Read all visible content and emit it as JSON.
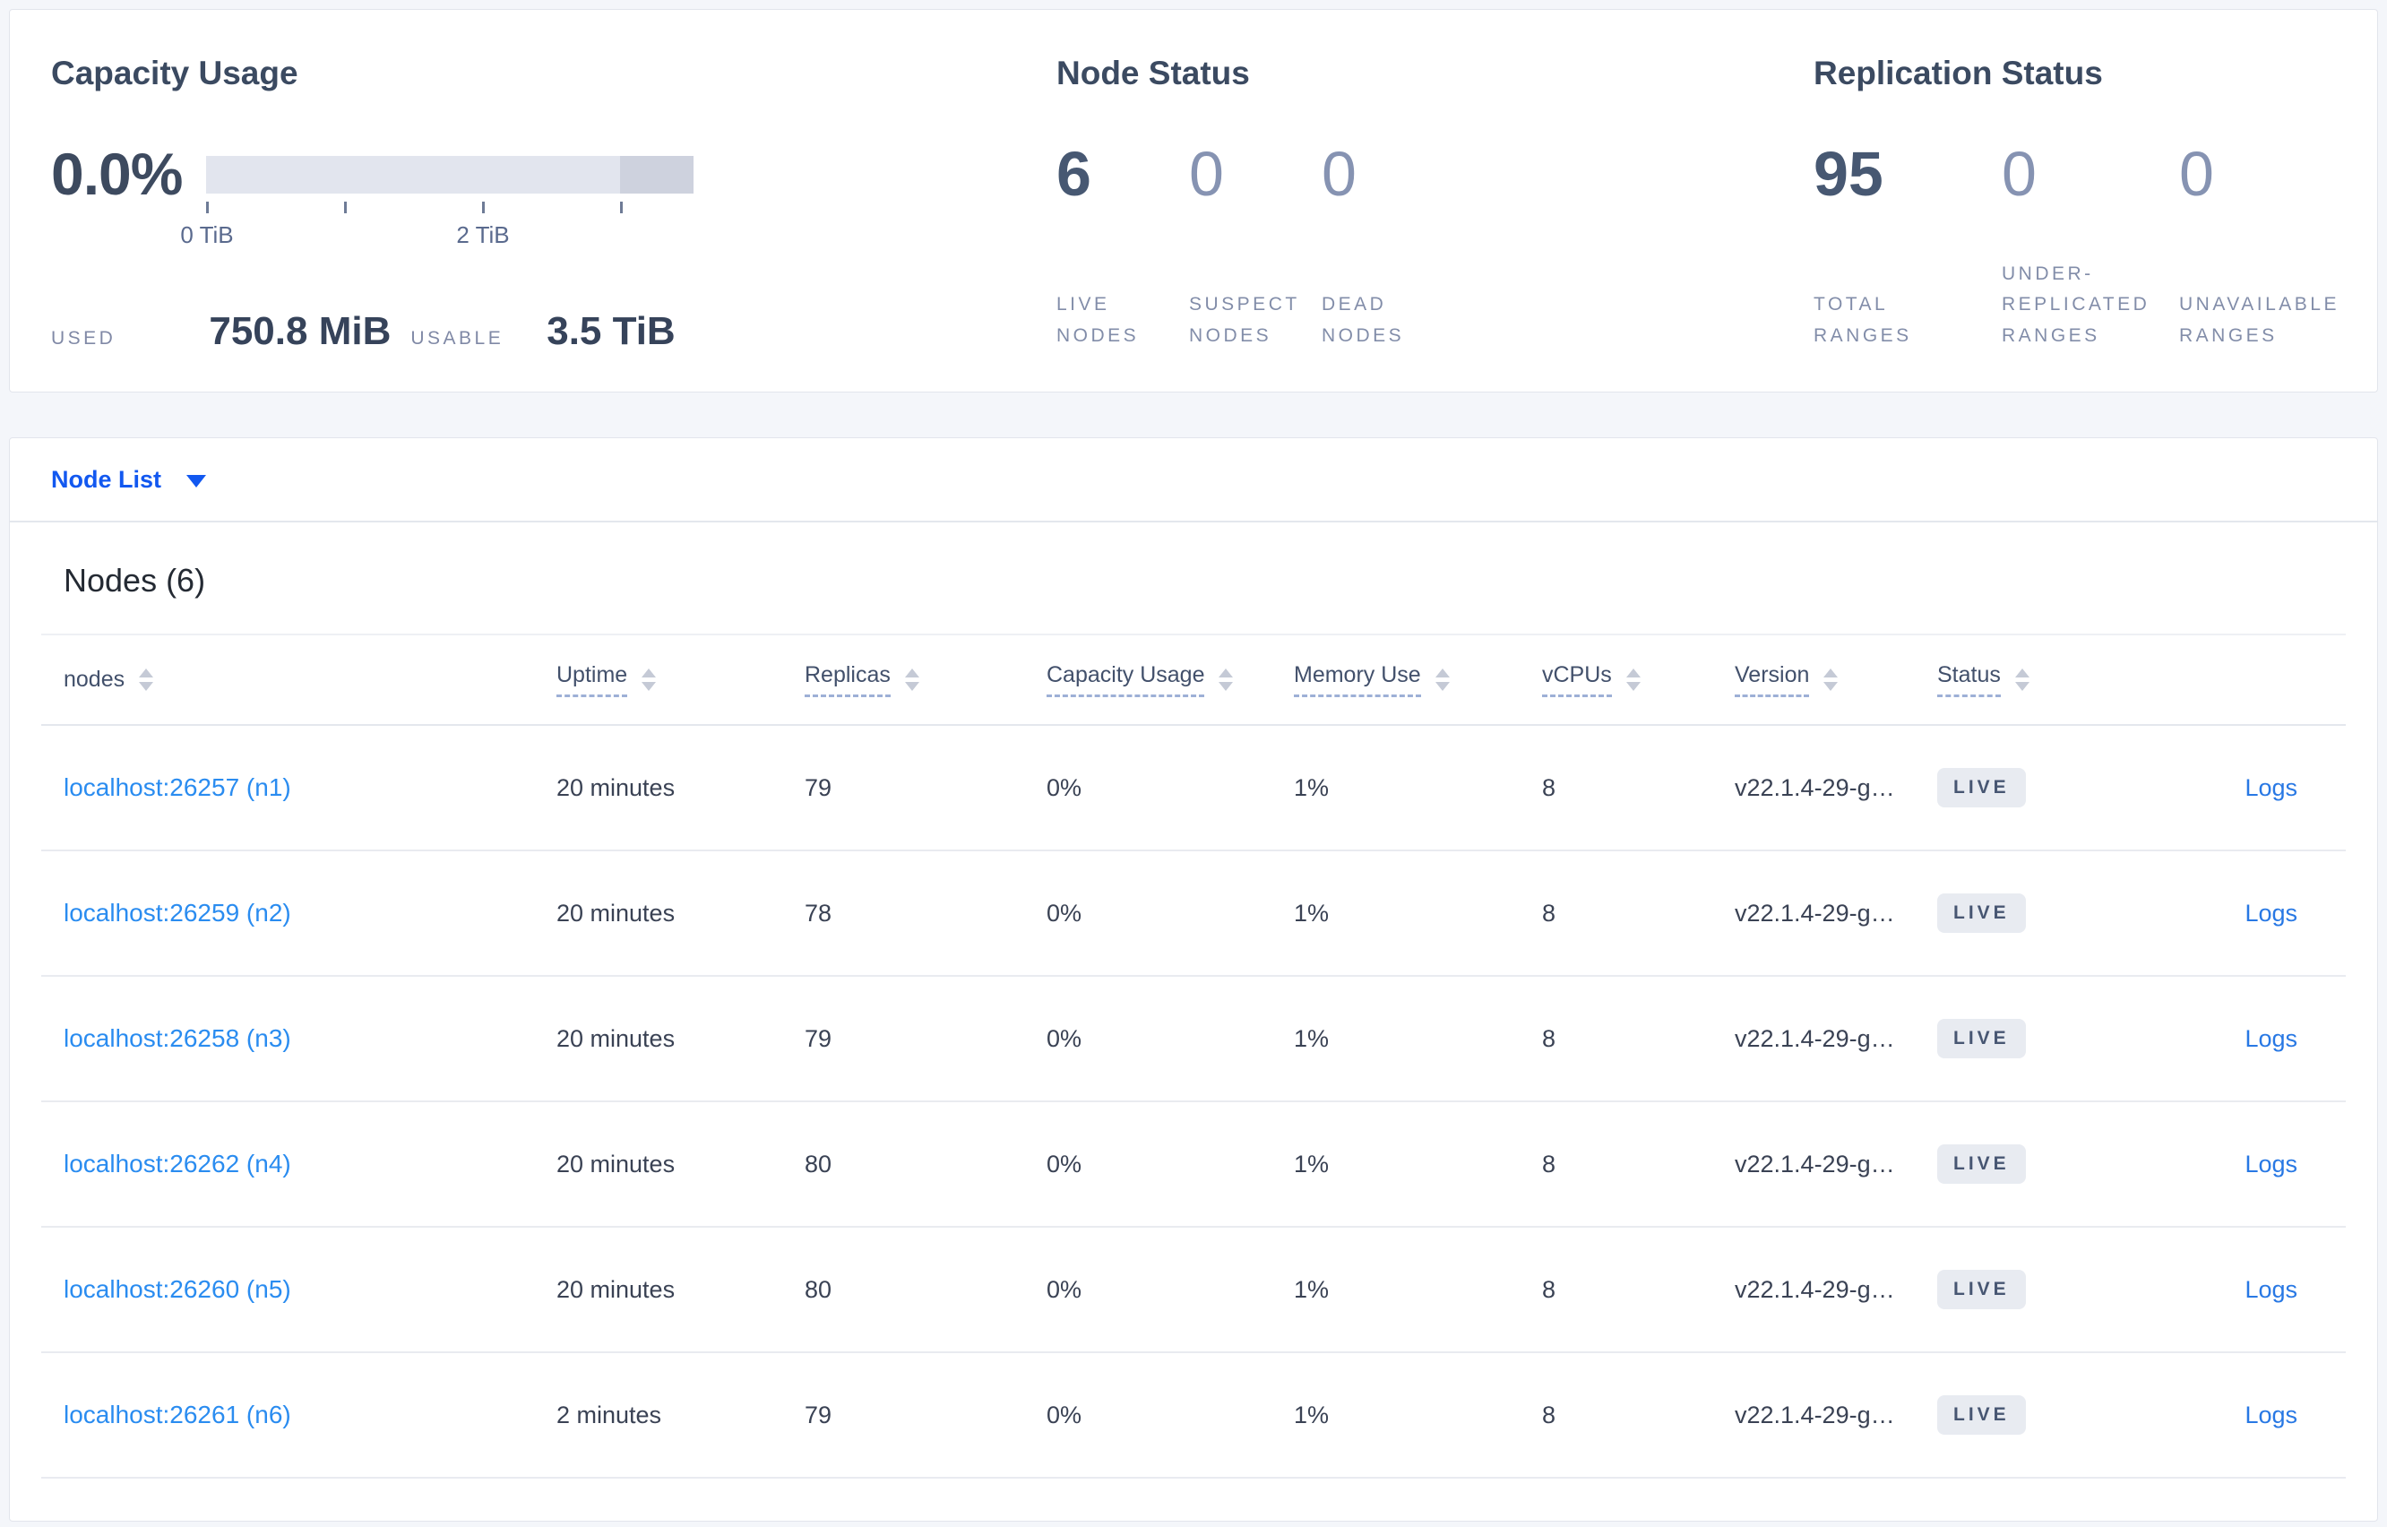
{
  "colors": {
    "accent_blue": "#1258f0",
    "table_link_blue": "#2a8cf0",
    "logs_link_blue": "#2878e4",
    "badge_bg": "#e8ebf1",
    "bar_light": "#e2e5ee",
    "bar_dark": "#ced2de"
  },
  "summary": {
    "capacity": {
      "title": "Capacity Usage",
      "percent": "0.0%",
      "axis_labels": [
        "0 TiB",
        "2 TiB"
      ],
      "used_label": "USED",
      "used_value": "750.8 MiB",
      "usable_label": "USABLE",
      "usable_value": "3.5 TiB"
    },
    "node_status": {
      "title": "Node Status",
      "stats": [
        {
          "value": "6",
          "muted": false,
          "label_lines": [
            "LIVE",
            "NODES"
          ]
        },
        {
          "value": "0",
          "muted": true,
          "label_lines": [
            "SUSPECT",
            "NODES"
          ]
        },
        {
          "value": "0",
          "muted": true,
          "label_lines": [
            "DEAD",
            "NODES"
          ]
        }
      ]
    },
    "replication": {
      "title": "Replication Status",
      "stats": [
        {
          "value": "95",
          "muted": false,
          "label_lines": [
            "TOTAL",
            "RANGES"
          ]
        },
        {
          "value": "0",
          "muted": true,
          "label_lines": [
            "UNDER-",
            "REPLICATED",
            "RANGES"
          ]
        },
        {
          "value": "0",
          "muted": true,
          "label_lines": [
            "UNAVAILABLE",
            "RANGES"
          ]
        }
      ]
    }
  },
  "chart_data": {
    "type": "bar",
    "title": "Capacity Usage",
    "percent_used": "0.0%",
    "used": "750.8 MiB",
    "usable": "3.5 TiB",
    "axis_ticks_tib": [
      0,
      1,
      2,
      3
    ],
    "axis_tick_labels": [
      "0 TiB",
      "2 TiB"
    ],
    "bar_total_tib": 3.5,
    "highlight_segment_tib": [
      3.0,
      3.5
    ]
  },
  "node_list": {
    "label": "Node List"
  },
  "table": {
    "title": "Nodes (6)",
    "columns": [
      {
        "label": "nodes",
        "underlined": false
      },
      {
        "label": "Uptime",
        "underlined": true
      },
      {
        "label": "Replicas",
        "underlined": true
      },
      {
        "label": "Capacity Usage",
        "underlined": true
      },
      {
        "label": "Memory Use",
        "underlined": true
      },
      {
        "label": "vCPUs",
        "underlined": true
      },
      {
        "label": "Version",
        "underlined": true
      },
      {
        "label": "Status",
        "underlined": true
      }
    ],
    "rows": [
      {
        "node": "localhost:26257 (n1)",
        "uptime": "20 minutes",
        "replicas": "79",
        "capacity": "0%",
        "memory": "1%",
        "vcpus": "8",
        "version": "v22.1.4-29-g…",
        "status": "LIVE",
        "logs": "Logs"
      },
      {
        "node": "localhost:26259 (n2)",
        "uptime": "20 minutes",
        "replicas": "78",
        "capacity": "0%",
        "memory": "1%",
        "vcpus": "8",
        "version": "v22.1.4-29-g…",
        "status": "LIVE",
        "logs": "Logs"
      },
      {
        "node": "localhost:26258 (n3)",
        "uptime": "20 minutes",
        "replicas": "79",
        "capacity": "0%",
        "memory": "1%",
        "vcpus": "8",
        "version": "v22.1.4-29-g…",
        "status": "LIVE",
        "logs": "Logs"
      },
      {
        "node": "localhost:26262 (n4)",
        "uptime": "20 minutes",
        "replicas": "80",
        "capacity": "0%",
        "memory": "1%",
        "vcpus": "8",
        "version": "v22.1.4-29-g…",
        "status": "LIVE",
        "logs": "Logs"
      },
      {
        "node": "localhost:26260 (n5)",
        "uptime": "20 minutes",
        "replicas": "80",
        "capacity": "0%",
        "memory": "1%",
        "vcpus": "8",
        "version": "v22.1.4-29-g…",
        "status": "LIVE",
        "logs": "Logs"
      },
      {
        "node": "localhost:26261 (n6)",
        "uptime": "2 minutes",
        "replicas": "79",
        "capacity": "0%",
        "memory": "1%",
        "vcpus": "8",
        "version": "v22.1.4-29-g…",
        "status": "LIVE",
        "logs": "Logs"
      }
    ]
  }
}
